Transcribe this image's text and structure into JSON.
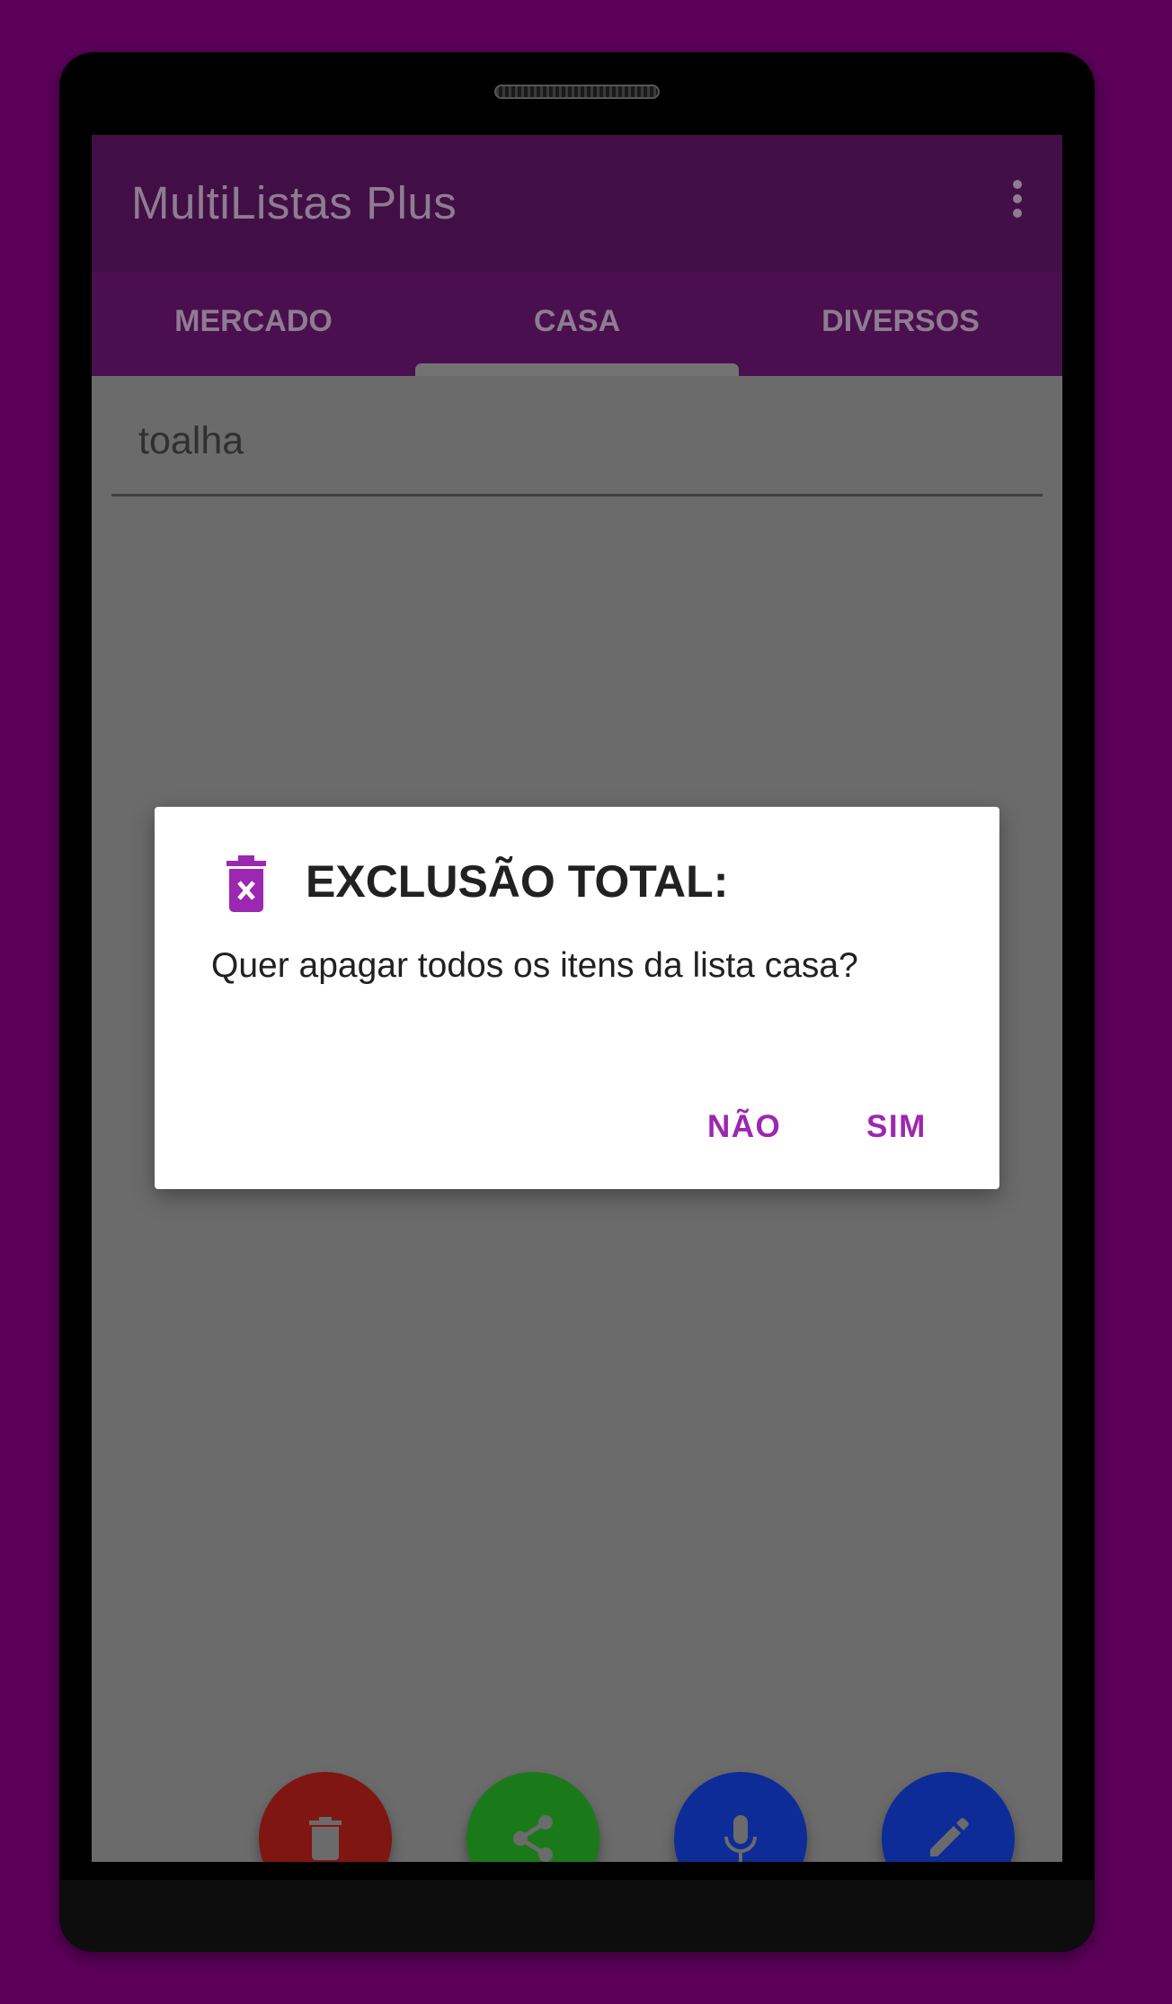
{
  "app": {
    "title": "MultiListas Plus"
  },
  "tabs": [
    {
      "label": "MERCADO",
      "selected": false
    },
    {
      "label": "CASA",
      "selected": true
    },
    {
      "label": "DIVERSOS",
      "selected": false
    }
  ],
  "input": {
    "value": "toalha"
  },
  "dialog": {
    "icon": "trash-x-icon",
    "title": "EXCLUSÃO TOTAL:",
    "message": "Quer apagar todos os itens da lista casa?",
    "negative_label": "NÃO",
    "positive_label": "SIM"
  },
  "fabs": [
    {
      "name": "delete-button",
      "icon": "trash-icon"
    },
    {
      "name": "share-button",
      "icon": "share-icon"
    },
    {
      "name": "mic-button",
      "icon": "microphone-icon"
    },
    {
      "name": "edit-button",
      "icon": "pencil-icon"
    }
  ],
  "colors": {
    "background": "#5c005a",
    "appbar": "#410f45",
    "accent": "#9c27b0",
    "fab_delete": "#7f1611",
    "fab_share": "#1a7a1a",
    "fab_blue": "#0d2c98"
  }
}
